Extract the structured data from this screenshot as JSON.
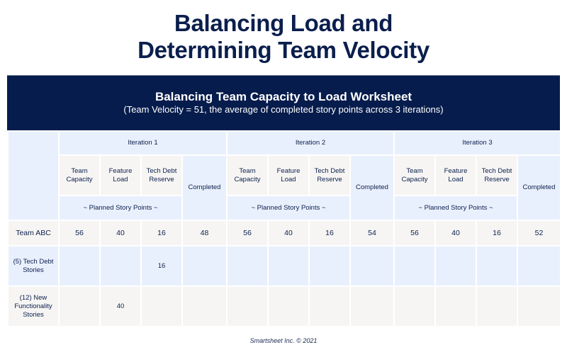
{
  "page_title": {
    "line1": "Balancing Load and",
    "line2": "Determining Team Velocity"
  },
  "worksheet": {
    "title": "Balancing Team Capacity to Load Worksheet",
    "subtitle": "(Team Velocity = 51, the average of completed story points across 3 iterations)",
    "iterations": [
      {
        "label": "Iteration 1",
        "columns": [
          "Team Capacity",
          "Feature Load",
          "Tech Debt Reserve",
          "Completed"
        ],
        "planned_label": "~ Planned Story Points ~"
      },
      {
        "label": "Iteration 2",
        "columns": [
          "Team Capacity",
          "Feature Load",
          "Tech Debt Reserve",
          "Completed"
        ],
        "planned_label": "~ Planned Story Points ~"
      },
      {
        "label": "Iteration 3",
        "columns": [
          "Team Capacity",
          "Feature Load",
          "Tech Debt Reserve",
          "Completed"
        ],
        "planned_label": "~ Planned Story Points ~"
      }
    ],
    "rows": [
      {
        "label": "Team ABC",
        "values": [
          "56",
          "40",
          "16",
          "48",
          "56",
          "40",
          "16",
          "54",
          "56",
          "40",
          "16",
          "52"
        ]
      },
      {
        "label": "(5) Tech Debt Stories",
        "values": [
          "",
          "",
          "16",
          "",
          "",
          "",
          "",
          "",
          "",
          "",
          "",
          ""
        ]
      },
      {
        "label": "(12) New Functionality Stories",
        "values": [
          "",
          "40",
          "",
          "",
          "",
          "",
          "",
          "",
          "",
          "",
          "",
          ""
        ]
      }
    ]
  },
  "footer": "Smartsheet Inc. © 2021",
  "colors": {
    "title_text": "#0b1f4d",
    "banner_bg": "#061c4c",
    "header_blue": "#e9f0fd",
    "cell_beige": "#f6f5f3"
  }
}
